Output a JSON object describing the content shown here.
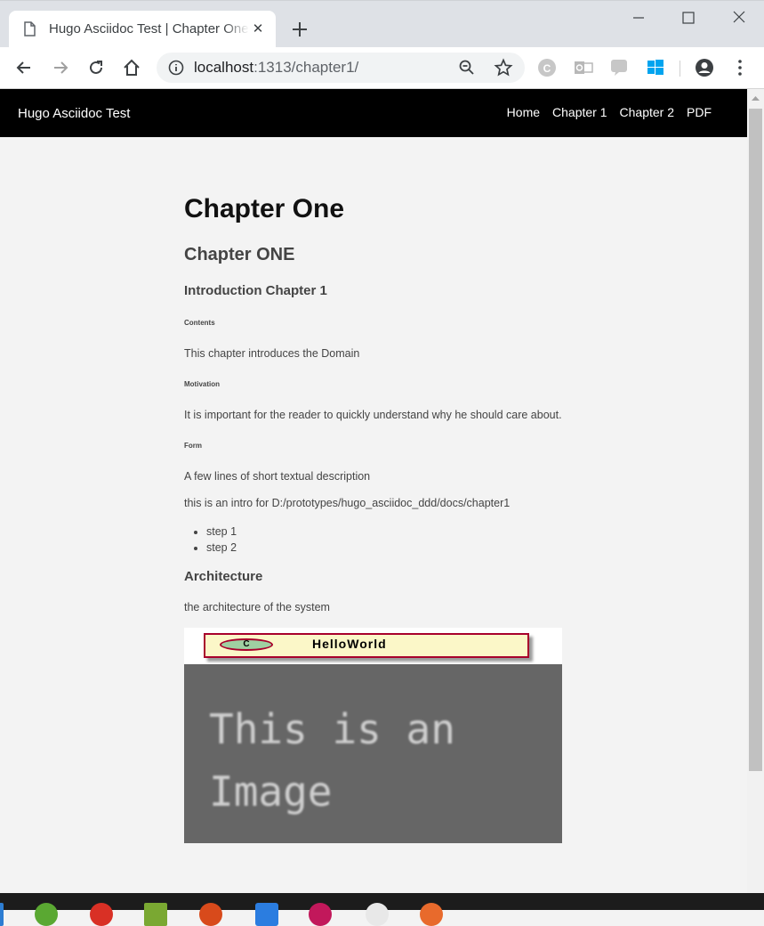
{
  "browser": {
    "tab_title": "Hugo Asciidoc Test | Chapter One",
    "url_host": "localhost",
    "url_path": ":1313/chapter1/",
    "extensions": [
      "c-extension-icon",
      "outlook-extension-icon",
      "wdk-extension-icon",
      "windows-extension-icon"
    ]
  },
  "site": {
    "brand": "Hugo Asciidoc Test",
    "nav": [
      "Home",
      "Chapter 1",
      "Chapter 2",
      "PDF"
    ]
  },
  "content": {
    "h1": "Chapter One",
    "h2": "Chapter ONE",
    "h3": "Introduction Chapter 1",
    "contents_heading": "Contents",
    "contents_text": "This chapter introduces the Domain",
    "motivation_heading": "Motivation",
    "motivation_text": "It is important for the reader to quickly understand why he should care about.",
    "form_heading": "Form",
    "form_text": "A few lines of short textual description",
    "intro_text": "this is an intro for D:/prototypes/hugo_asciidoc_ddd/docs/chapter1",
    "steps": [
      "step 1",
      "step 2"
    ],
    "architecture_heading": "Architecture",
    "architecture_text": "the architecture of the system",
    "diagram_class_marker": "C",
    "diagram_class_name": "HelloWorld",
    "image_text_line1": "This is an",
    "image_text_line2": "Image"
  },
  "colors": {
    "nav_bg": "#000000",
    "page_bg": "#f3f3f3",
    "diagram_border": "#a8002c",
    "image_bg": "#666666"
  }
}
